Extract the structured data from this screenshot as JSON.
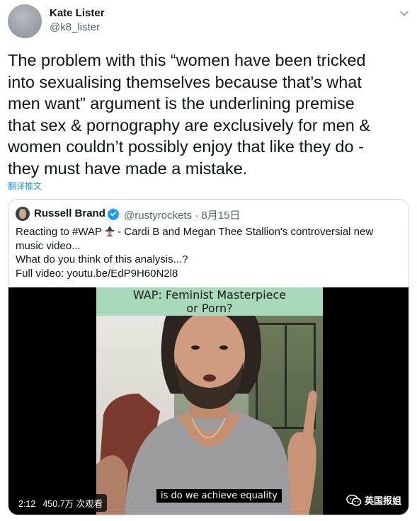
{
  "author": {
    "name": "Kate Lister",
    "handle": "@k8_lister"
  },
  "tweet": {
    "text": "The problem with this “women have been tricked\ninto sexualising themselves because that’s what\nmen want” argument is the underlining premise\nthat sex & pornography are exclusively for men &\nwomen couldn’t possibly enjoy that like they do -\nthey must have made a mistake.",
    "translate_label": "翻译推文"
  },
  "quote": {
    "name": "Russell Brand",
    "handle": "@rustyrockets · 8月15日",
    "line1_pre": "Reacting to #WAP",
    "line1_post": " - Cardi B and Megan Thee Stallion's controversial new",
    "line2": "music video...",
    "line3": "What do you think of this analysis...?",
    "line4": "Full video: youtu.be/EdP9H60N2l8",
    "video": {
      "banner_line1": "WAP: Feminist Masterpiece",
      "banner_line2": "or Porn?",
      "subtitle": "is do we achieve equality",
      "duration": "2:12",
      "views": "450.7万 次观看",
      "watermark": "英国报姐"
    }
  },
  "colors": {
    "link": "#1d9bf0",
    "verified": "#1d9bf0",
    "banner": "#a8d9b8"
  },
  "icons": [
    "chevron-down-icon",
    "verified-badge-icon",
    "witch-emoji-icon",
    "wechat-icon"
  ]
}
